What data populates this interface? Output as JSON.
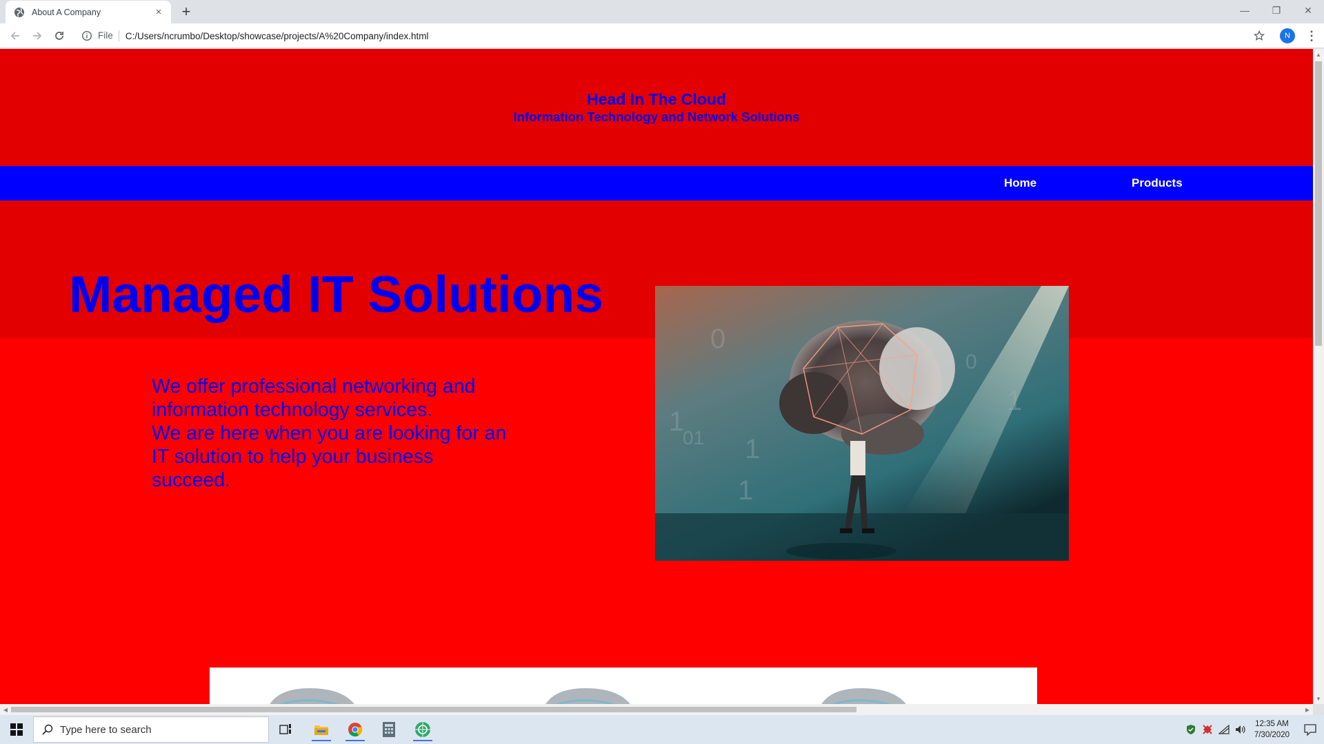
{
  "browser": {
    "tab_title": "About A Company",
    "tab_close": "×",
    "new_tab": "+",
    "file_label": "File",
    "url": "C:/Users/ncrumbo/Desktop/showcase/projects/A%20Company/index.html",
    "profile_initial": "N",
    "menu_glyph": "⋮",
    "window_minimize": "—",
    "window_restore": "❐",
    "window_close": "✕"
  },
  "page": {
    "site_title": "Head In The Cloud",
    "site_tagline": "Information Technology and Network Solutions",
    "nav": [
      {
        "label": "Home"
      },
      {
        "label": "Products"
      }
    ],
    "hero_heading": "Managed IT Solutions",
    "hero_paragraph_1": "We offer professional networking and information technology services.",
    "hero_paragraph_2": "We are here when you are looking for an IT solution to help your business succeed."
  },
  "taskbar": {
    "search_placeholder": "Type here to search",
    "time": "12:35 AM",
    "date": "7/30/2020"
  },
  "colors": {
    "header_bg": "#e30000",
    "page_bg": "#ff0000",
    "nav_bg": "#0000ff",
    "text_blue": "#0000ee"
  },
  "icons": [
    "globe-favicon-icon",
    "back-arrow-icon",
    "forward-arrow-icon",
    "reload-icon",
    "info-icon",
    "star-icon",
    "windows-start-icon",
    "search-icon",
    "task-view-icon",
    "file-explorer-icon",
    "chrome-icon",
    "calculator-icon",
    "network-app-icon",
    "security-shield-icon",
    "antivirus-icon",
    "wifi-icon",
    "volume-icon",
    "notifications-icon"
  ]
}
